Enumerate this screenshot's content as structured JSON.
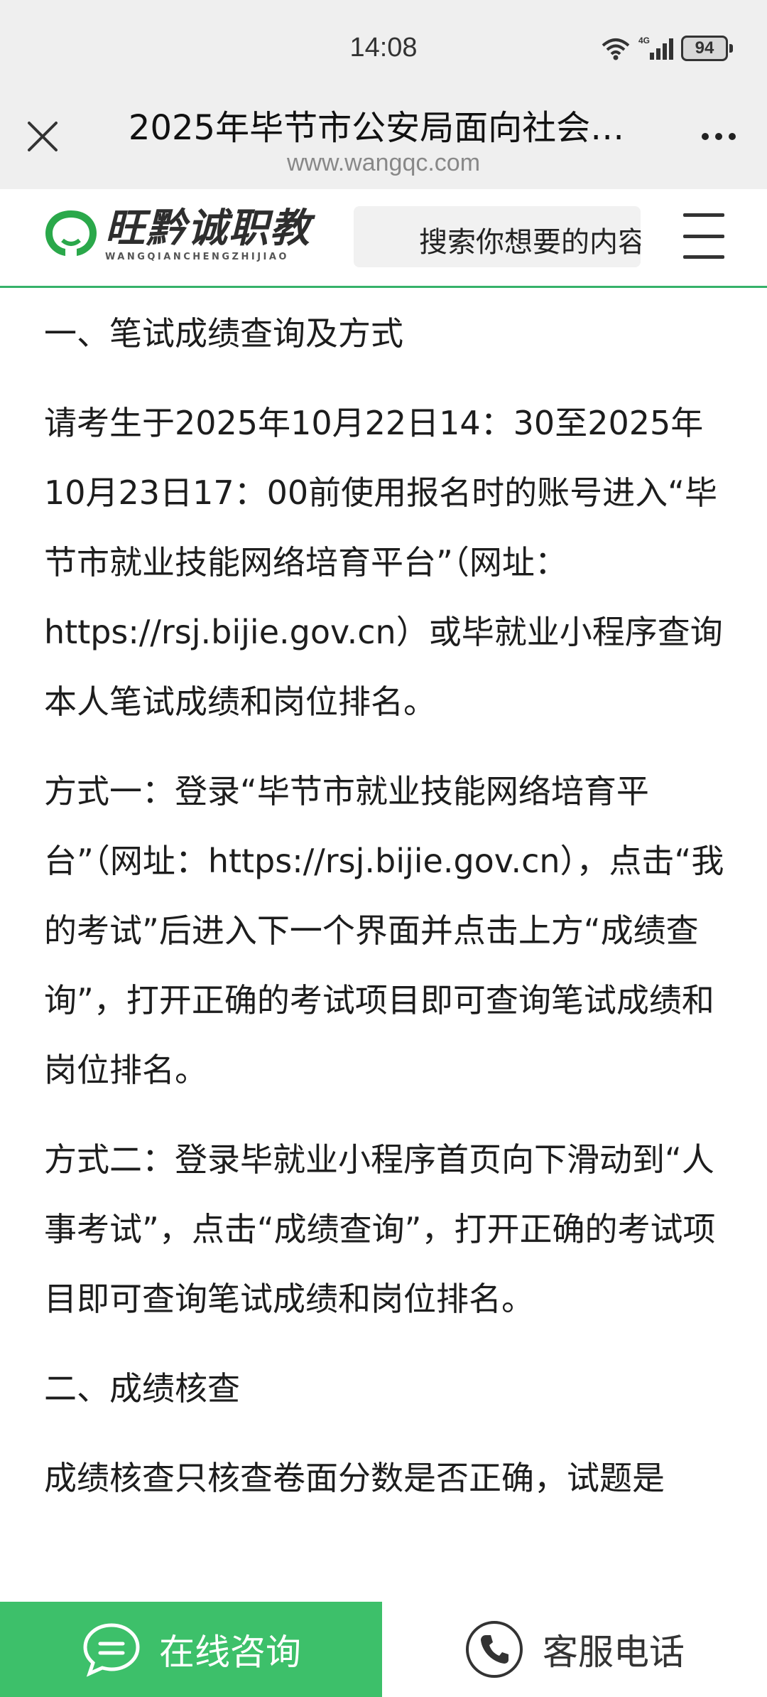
{
  "status_bar": {
    "time": "14:08",
    "network": "4G",
    "battery": "94"
  },
  "browser": {
    "page_title": "2025年毕节市公安局面向社会…",
    "url": "www.wangqc.com"
  },
  "site": {
    "logo_cn": "旺黔诚职教",
    "logo_en": "WANGQIANCHENGZHIJIAO",
    "search_placeholder": "搜索你想要的内容"
  },
  "article": {
    "heading1": "一、笔试成绩查询及方式",
    "para1": "请考生于2025年10月22日14：30至2025年10月23日17：00前使用报名时的账号进入“毕节市就业技能网络培育平台”（网址：https://rsj.bijie.gov.cn）或毕就业小程序查询本人笔试成绩和岗位排名。",
    "para2": "方式一：登录“毕节市就业技能网络培育平台”（网址：https://rsj.bijie.gov.cn），点击“我的考试”后进入下一个界面并点击上方“成绩查询”，打开正确的考试项目即可查询笔试成绩和岗位排名。",
    "para3": "方式二：登录毕就业小程序首页向下滑动到“人事考试”，点击“成绩查询”，打开正确的考试项目即可查询笔试成绩和岗位排名。",
    "heading2": "二、成绩核查",
    "para4": "成绩核查只核查卷面分数是否正确，试题是"
  },
  "bottom_bar": {
    "consult_label": "在线咨询",
    "phone_label": "客服电话"
  },
  "colors": {
    "accent_green": "#3dc06a",
    "divider_green": "#35b26a"
  },
  "icons": [
    "wifi-icon",
    "signal-icon",
    "battery-icon",
    "close-icon",
    "more-icon",
    "menu-icon",
    "chat-icon",
    "phone-icon"
  ]
}
